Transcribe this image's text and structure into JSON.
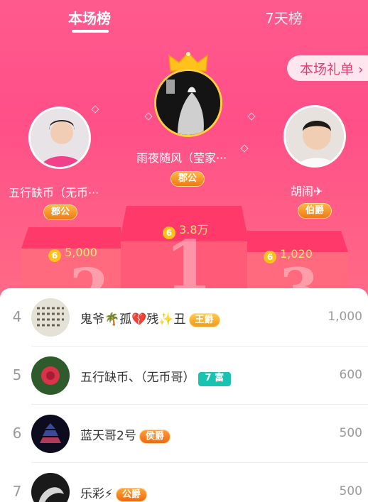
{
  "tabs": [
    {
      "label": "本场榜",
      "active": true
    },
    {
      "label": "7天榜",
      "active": false
    }
  ],
  "gift_list_button": {
    "label": "本场礼单",
    "arrow": "›"
  },
  "podium": {
    "first": {
      "name": "雨夜随风（莹家···",
      "title": "郡公",
      "score": "3.8万",
      "rank_numeral": "1"
    },
    "second": {
      "name": "五行缺币（无币···",
      "title": "郡公",
      "score": "5,000",
      "rank_numeral": "2"
    },
    "third": {
      "name": "胡闹✈",
      "title": "伯爵",
      "score": "1,020",
      "rank_numeral": "3"
    }
  },
  "coin_symbol": "6",
  "list": [
    {
      "rank": "4",
      "name": "鬼爷🌴孤💔残✨丑",
      "badge": "王爵",
      "badge_type": "king",
      "score": "1,000"
    },
    {
      "rank": "5",
      "name": "五行缺币、（无币哥）",
      "badge": "7 富",
      "badge_type": "rich",
      "score": "600"
    },
    {
      "rank": "6",
      "name": "蓝天哥2号",
      "badge": "侯爵",
      "badge_type": "hou",
      "score": "500"
    },
    {
      "rank": "7",
      "name": "乐彩⚡",
      "badge": "公爵",
      "badge_type": "gong",
      "score": "500"
    }
  ],
  "colors": {
    "accent": "#ff4f88",
    "gold": "#ffc21b",
    "rich_badge": "#19c3b1"
  }
}
